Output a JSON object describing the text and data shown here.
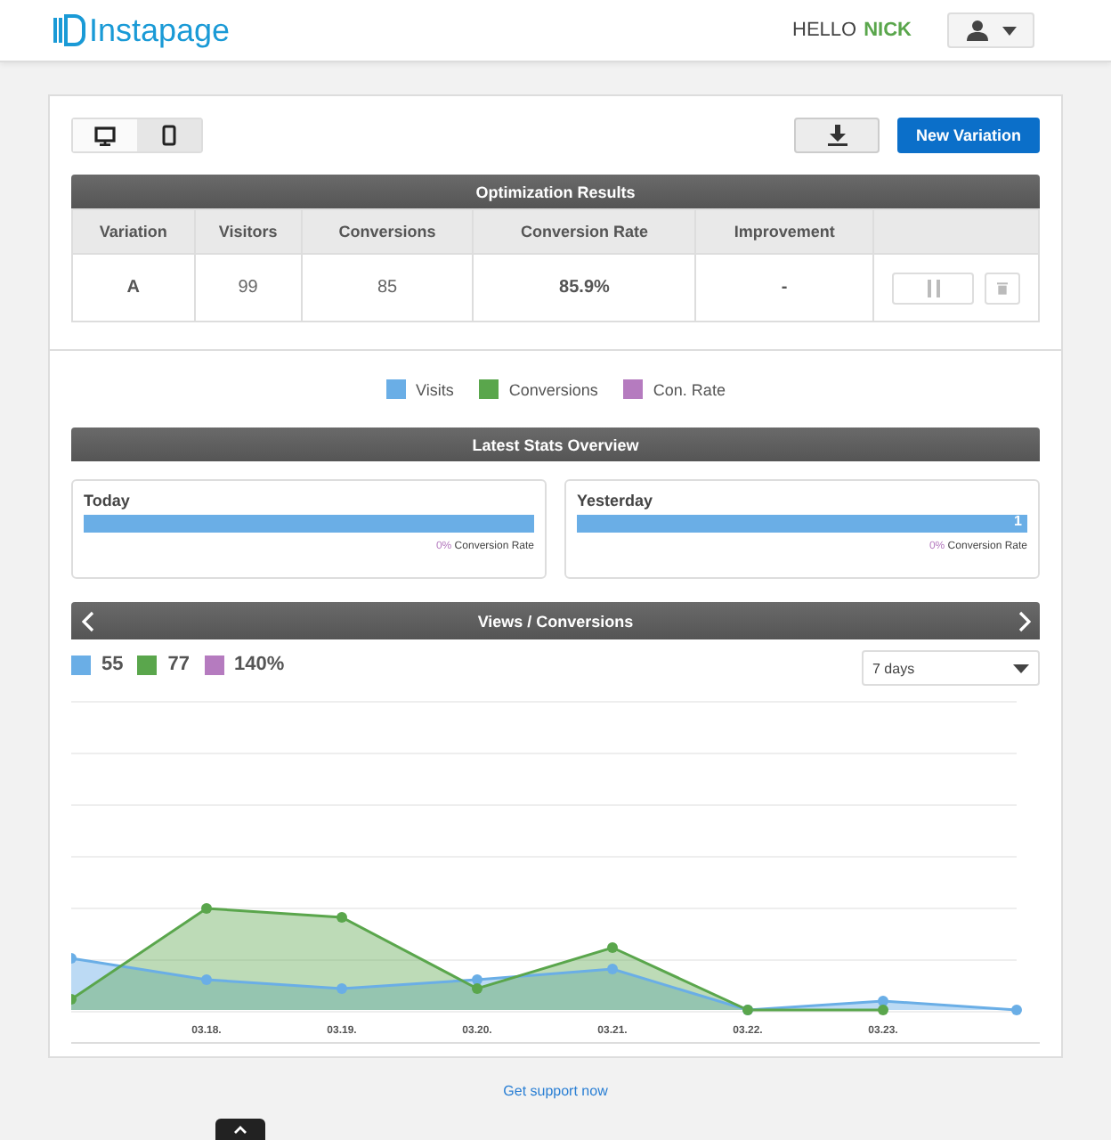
{
  "header": {
    "logo": "Instapage",
    "greeting": "HELLO",
    "user": "NICK"
  },
  "devices": [
    {
      "kind": "desktop",
      "selected": true
    },
    {
      "kind": "mobile",
      "selected": false
    }
  ],
  "actions": {
    "new_button": "New Variation"
  },
  "results": {
    "title": "Optimization Results",
    "columns": [
      "Variation",
      "Visitors",
      "Conversions",
      "Conversion Rate",
      "Improvement"
    ],
    "rows": [
      {
        "variation": "A",
        "visitors": "99",
        "conversions": "85",
        "rate": "85.9%",
        "improvement": "-"
      }
    ]
  },
  "legend": [
    {
      "label": "Visits",
      "color": "#6aaee6"
    },
    {
      "label": "Conversions",
      "color": "#5aa64c"
    },
    {
      "label": "Con. Rate",
      "color": "#b57bbf"
    }
  ],
  "stats": {
    "title": "Latest Stats Overview",
    "cards": [
      {
        "title": "Today",
        "level": 1,
        "rate": "0%",
        "rate_label": "Conversion Rate"
      },
      {
        "title": "Yesterday",
        "level": 1,
        "value": "1",
        "rate": "0%",
        "rate_label": "Conversion Rate"
      }
    ]
  },
  "views": {
    "title": "Views / Conversions",
    "totals": [
      {
        "value": "55",
        "color": "#6aaee6"
      },
      {
        "value": "77",
        "color": "#5aa64c"
      },
      {
        "value": "140%",
        "color": "#b57bbf"
      }
    ],
    "period": "7 days",
    "x_labels": [
      "03.18.",
      "03.19.",
      "03.20.",
      "03.21.",
      "03.22.",
      "03.23."
    ]
  },
  "footer": {
    "link": "Get support now"
  }
}
